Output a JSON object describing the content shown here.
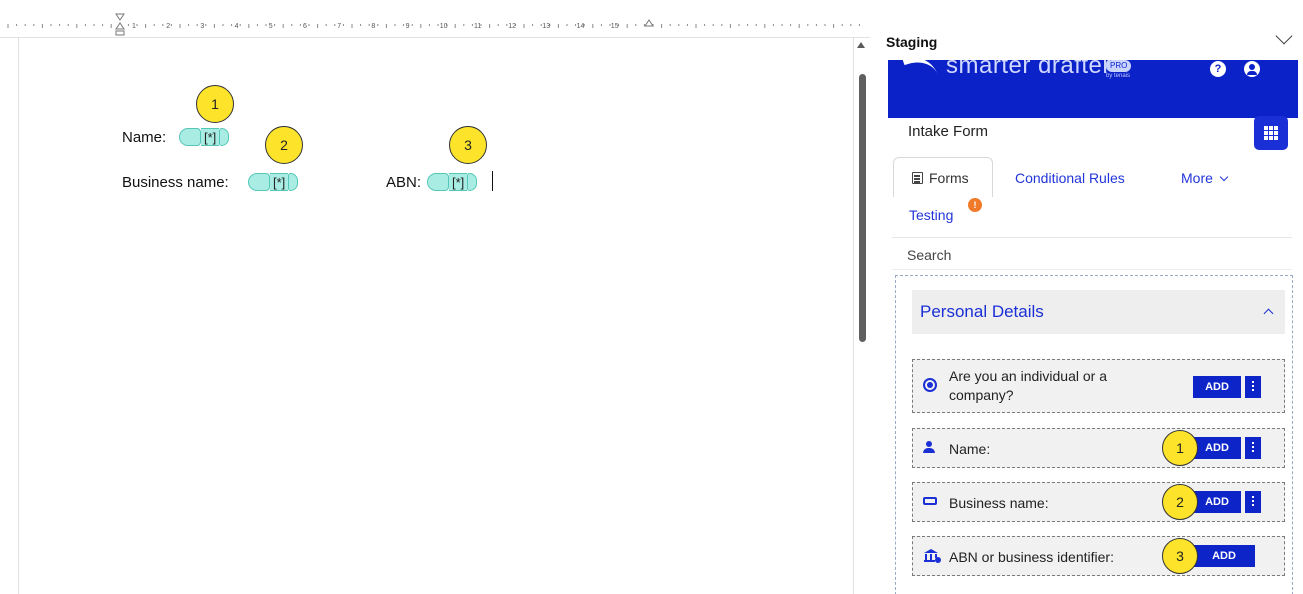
{
  "document": {
    "fields": [
      {
        "label": "Name:",
        "placeholder": "[*]",
        "callout": "1"
      },
      {
        "label": "Business name:",
        "placeholder": "[*]",
        "callout": "2"
      },
      {
        "label": "ABN:",
        "placeholder": "[*]",
        "callout": "3"
      }
    ]
  },
  "panel": {
    "header_title": "Staging",
    "brand_name": "smarter drafter",
    "brand_pro": "PRO",
    "brand_by": "by tenais",
    "help_glyph": "?",
    "form_title": "Intake Form",
    "tabs": {
      "forms": "Forms",
      "conditional_rules": "Conditional Rules",
      "more": "More",
      "testing": "Testing",
      "testing_badge": "!"
    },
    "search_label": "Search",
    "section": {
      "title": "Personal Details",
      "fields": [
        {
          "label_line1": "Are you an individual or a",
          "label_line2": "company?",
          "add_label": "ADD",
          "icon": "radio-icon"
        },
        {
          "label": "Name:",
          "add_label": "ADD",
          "icon": "person-icon",
          "callout": "1"
        },
        {
          "label": "Business name:",
          "add_label": "ADD",
          "icon": "textbox-icon",
          "callout": "2"
        },
        {
          "label": "ABN or business identifier:",
          "add_label": "ADD",
          "icon": "bank-icon",
          "callout": "3"
        }
      ]
    }
  },
  "colors": {
    "accent": "#0d25c8",
    "callout": "#fde42b",
    "field_chip": "#a9ece3",
    "badge": "#f07a2a"
  }
}
